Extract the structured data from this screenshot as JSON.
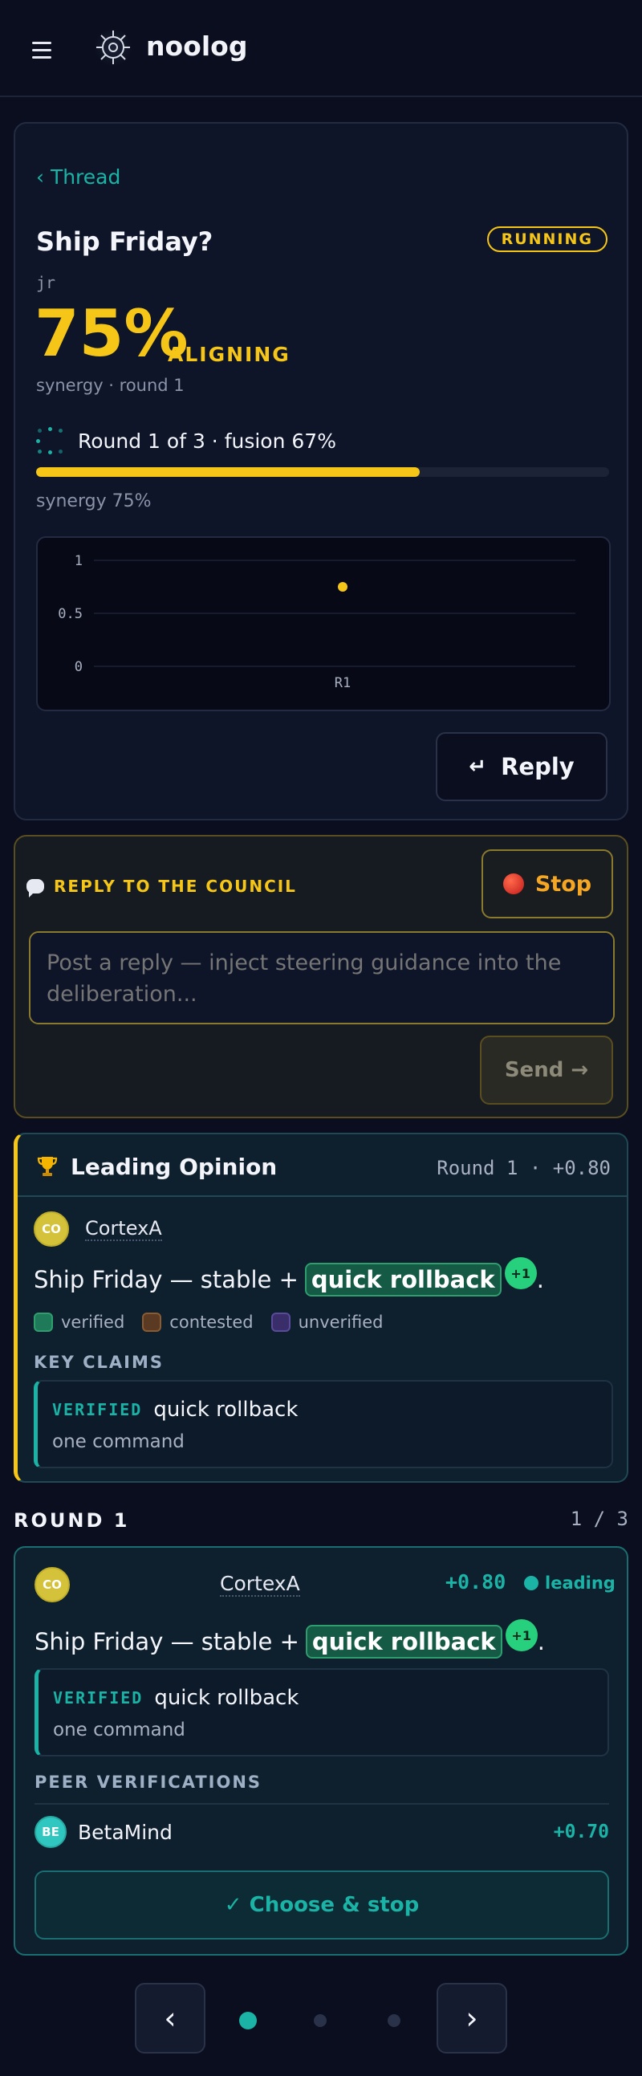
{
  "header": {
    "brand": "noolog"
  },
  "thread": {
    "back_label": "‹ Thread",
    "title": "Ship Friday?",
    "status_badge": "RUNNING",
    "author": "jr",
    "score_pct": "75%",
    "score_state": "ALIGNING",
    "subline": "synergy · round 1",
    "round_status": "Round 1 of 3 · fusion 67%",
    "progress_fraction": 0.67,
    "synergy_label": "synergy 75%",
    "reply_label": "Reply"
  },
  "chart_data": {
    "type": "scatter",
    "categories": [
      "R1"
    ],
    "values": [
      0.75
    ],
    "yticks": [
      "1",
      "0.5",
      "0"
    ],
    "ylim": [
      0,
      1
    ],
    "grid": true,
    "colors": {
      "point": "#f5c518"
    }
  },
  "council": {
    "label": "REPLY TO THE COUNCIL",
    "stop_label": "Stop",
    "input_placeholder": "Post a reply — inject steering guidance into the deliberation...",
    "send_label": "Send →"
  },
  "leading": {
    "title": "Leading Opinion",
    "meta": "Round 1 · +0.80",
    "agent_initials": "CO",
    "agent_name": "CortexA",
    "statement_prefix": "Ship Friday — stable +",
    "statement_chip": "quick rollback",
    "statement_badge": "+1",
    "statement_suffix": ".",
    "legend": [
      {
        "label": "verified",
        "color": "#1f7a5a"
      },
      {
        "label": "contested",
        "color": "#7a4a2a"
      },
      {
        "label": "unverified",
        "color": "#4a3a8a"
      }
    ],
    "key_claims_label": "KEY CLAIMS",
    "claim_tag": "VERIFIED",
    "claim_title": "quick rollback",
    "claim_sub": "one command"
  },
  "round": {
    "header": "ROUND 1",
    "count": "1 / 3",
    "agent_initials": "CO",
    "agent_name": "CortexA",
    "score": "+0.80",
    "leading_label": "leading",
    "statement_prefix": "Ship Friday — stable +",
    "statement_chip": "quick rollback",
    "statement_badge": "+1",
    "statement_suffix": ".",
    "claim_tag": "VERIFIED",
    "claim_title": "quick rollback",
    "claim_sub": "one command",
    "peer_label": "PEER VERIFICATIONS",
    "peer_initials": "BE",
    "peer_name": "BetaMind",
    "peer_score": "+0.70",
    "choose_label": "✓ Choose & stop"
  },
  "pager": {
    "prev": "‹",
    "next": "›",
    "active_index": 0,
    "count": 3
  },
  "colors": {
    "accent_teal": "#1ab3a6",
    "accent_yellow": "#f5c518",
    "background": "#0a0e1e"
  }
}
